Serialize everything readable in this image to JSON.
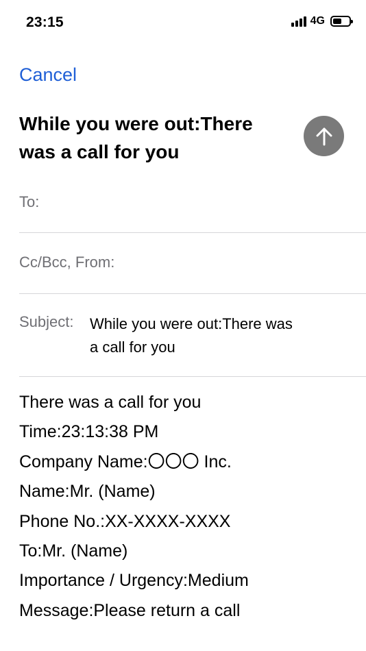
{
  "status_bar": {
    "time": "23:15",
    "network": "4G",
    "battery_level": 0.55
  },
  "compose": {
    "cancel_label": "Cancel",
    "title": "While you were out:There was a call for you",
    "send_icon": "arrow-up-icon",
    "send_color": "#7a7a7a",
    "accent_color": "#1f5fd6"
  },
  "fields": {
    "to_label": "To:",
    "cc_bcc_from_label": "Cc/Bcc, From:",
    "subject_label": "Subject:",
    "subject_value": "While you were out:There was a call for you"
  },
  "body": {
    "lines": [
      "There was a call for you",
      "Time:23:13:38 PM",
      "Company Name:〇〇〇 Inc.",
      "Name:Mr. (Name)",
      "Phone No.:XX-XXXX-XXXX",
      "To:Mr. (Name)",
      "Importance / Urgency:Medium",
      "Message:Please return a call"
    ]
  }
}
